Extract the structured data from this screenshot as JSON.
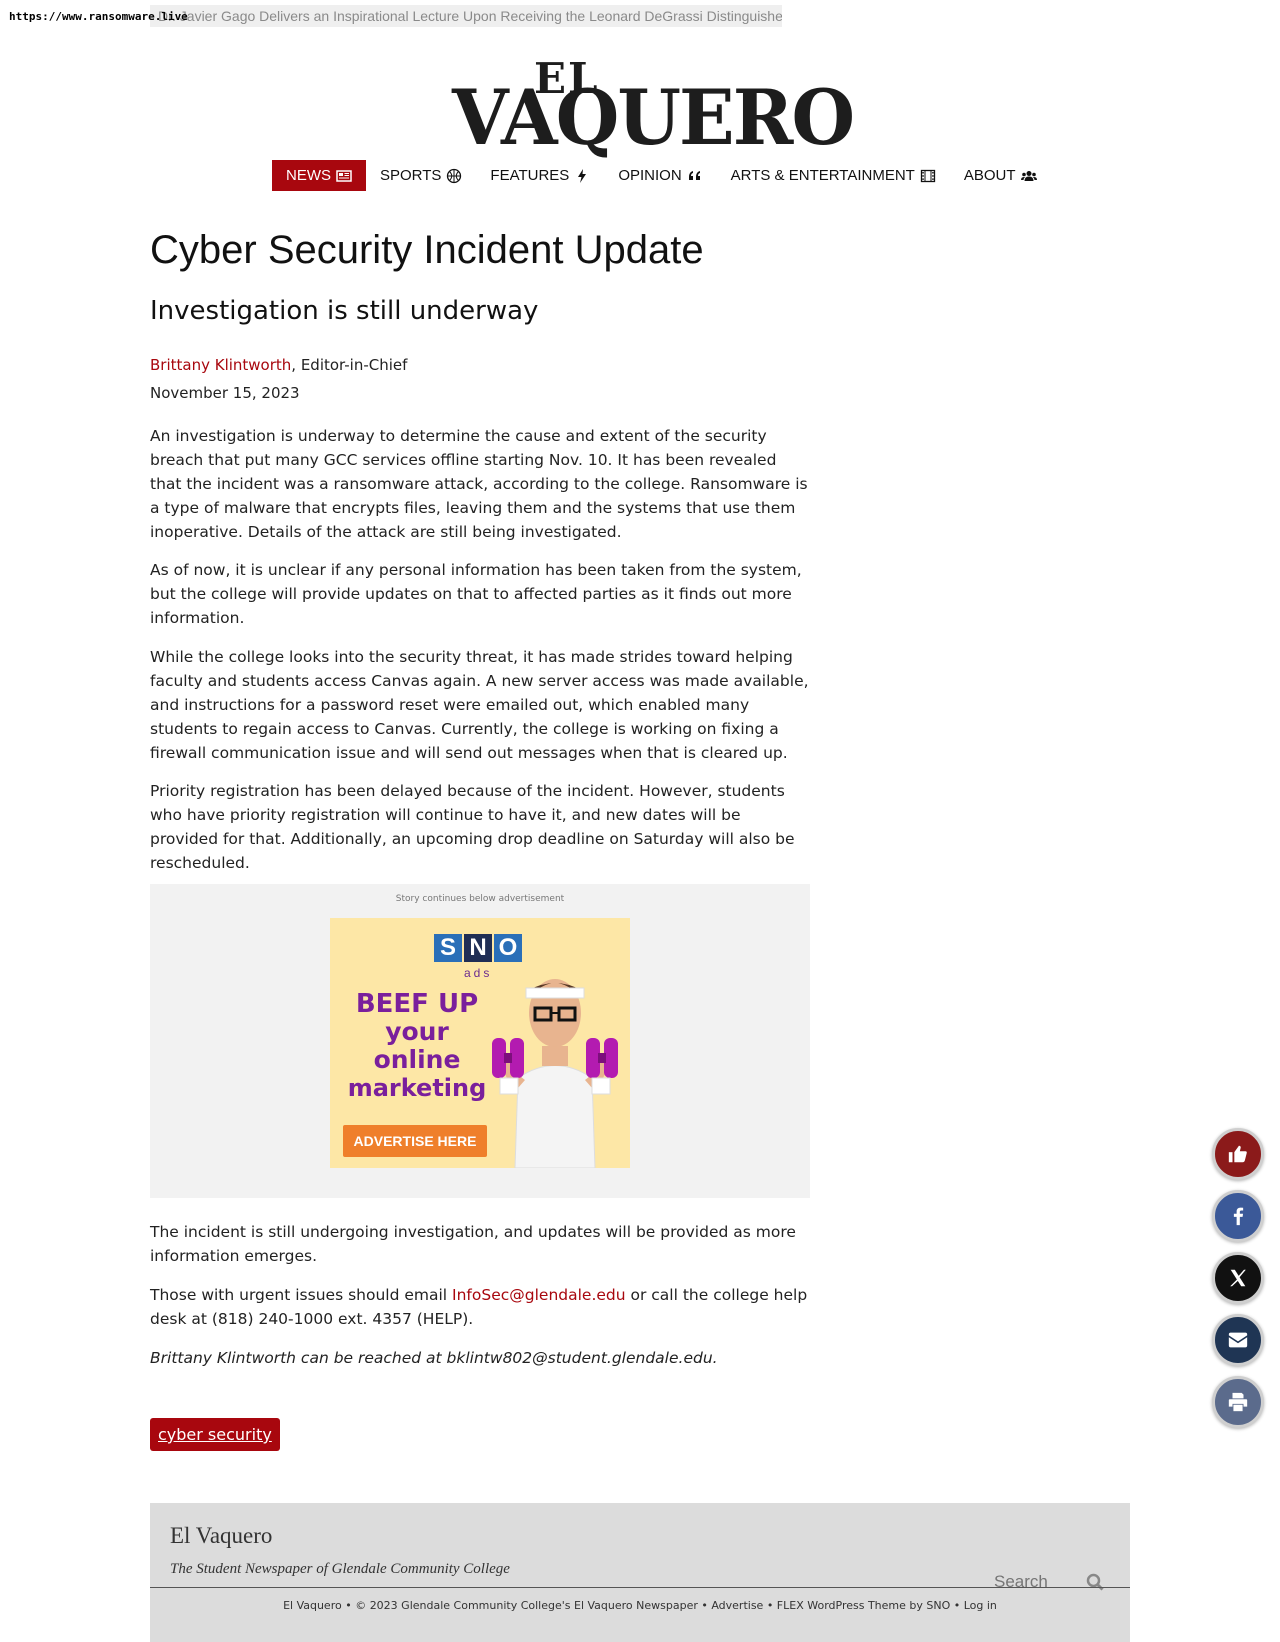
{
  "browser": {
    "url": "https://www.ransomware.live",
    "ticker_text": "Dr. Javier Gago Delivers an Inspirational Lecture Upon Receiving the Leonard DeGrassi Distinguished Faculty Award"
  },
  "masthead": {
    "logo_top": "EL",
    "logo_bottom": "VAQUERO"
  },
  "nav": {
    "items": [
      {
        "label": "NEWS",
        "icon": "newspaper-icon",
        "active": true
      },
      {
        "label": "SPORTS",
        "icon": "basketball-icon",
        "active": false
      },
      {
        "label": "FEATURES",
        "icon": "bolt-icon",
        "active": false
      },
      {
        "label": "OPINION",
        "icon": "quote-icon",
        "active": false
      },
      {
        "label": "ARTS & ENTERTAINMENT",
        "icon": "film-icon",
        "active": false
      },
      {
        "label": "ABOUT",
        "icon": "users-icon",
        "active": false
      }
    ]
  },
  "article": {
    "headline": "Cyber Security Incident Update",
    "subheadline": "Investigation is still underway",
    "author": "Brittany Klintworth",
    "author_role": ", Editor-in-Chief",
    "date": "November 15, 2023",
    "paragraphs": [
      "An investigation is underway to determine the cause and extent of the security breach that put many GCC services offline starting Nov. 10. It has been revealed that the incident was a ransomware attack, according to the college. Ransomware is a type of malware that encrypts files, leaving them and the systems that use them inoperative. Details of the attack are still being investigated.",
      "As of now, it is unclear if any personal information has been taken from the system, but the college will provide updates on that to affected parties as it finds out more information.",
      "While the college looks into the security threat, it has made strides toward helping faculty and students access Canvas again. A new server access was made available, and instructions for a password reset were emailed out, which enabled many students to regain access to Canvas. Currently, the college is working on fixing a firewall communication issue and will send out messages when that is cleared up.",
      "Priority registration has been delayed because of the incident. However, students who have priority registration will continue to have it, and new dates will be provided for that. Additionally, an upcoming drop deadline on Saturday will also be rescheduled.",
      "The incident is still undergoing investigation, and updates will be provided as more information emerges."
    ],
    "contact_before": "Those with urgent issues should email ",
    "contact_email": "InfoSec@glendale.edu",
    "contact_after": " or call the college help desk at (818) 240-1000 ext. 4357 (HELP).",
    "reach_line": "Brittany Klintworth can be reached at bklintw802@student.glendale.edu.",
    "tag": "cyber security"
  },
  "ad": {
    "label": "Story continues below advertisement",
    "brand": [
      "S",
      "N",
      "O"
    ],
    "brand_sub": "ads",
    "line1": "BEEF UP",
    "line2": "your",
    "line3": "online",
    "line4": "marketing",
    "button": "ADVERTISE HERE"
  },
  "footer": {
    "title": "El Vaquero",
    "subtitle": "The Student Newspaper of Glendale Community College",
    "search_placeholder": "Search",
    "bottom_text": "El Vaquero • © 2023 Glendale Community College's El Vaquero Newspaper • Advertise • FLEX WordPress Theme by SNO • Log in"
  },
  "share_buttons": [
    {
      "name": "like-button",
      "icon": "thumbs-up-icon",
      "color": "#8b1a1a"
    },
    {
      "name": "facebook-share-button",
      "icon": "facebook-icon",
      "color": "#3b5998"
    },
    {
      "name": "x-share-button",
      "icon": "x-icon",
      "color": "#111111"
    },
    {
      "name": "email-share-button",
      "icon": "envelope-icon",
      "color": "#1f3554"
    },
    {
      "name": "print-button",
      "icon": "printer-icon",
      "color": "#5b6b8c"
    }
  ],
  "colors": {
    "accent": "#a8070e",
    "ad_background": "#fde7a6",
    "footer_background": "#dcdcdc"
  }
}
